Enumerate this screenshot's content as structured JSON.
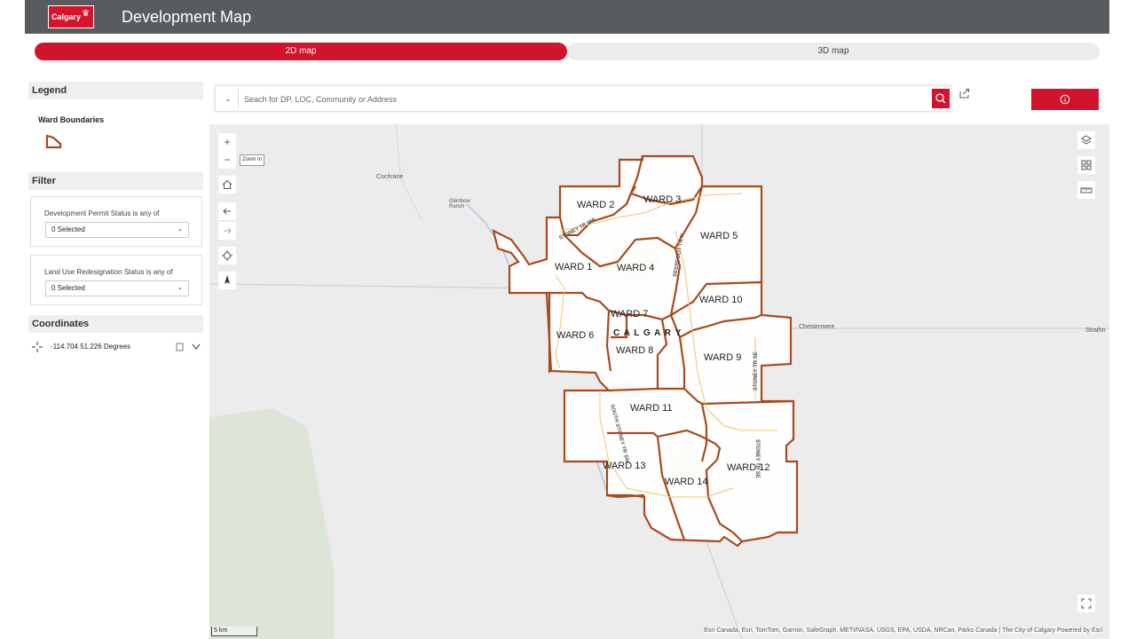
{
  "header": {
    "logo_text": "Calgary",
    "title": "Development Map"
  },
  "tabs": [
    {
      "label": "2D map",
      "active": true
    },
    {
      "label": "3D map",
      "active": false
    }
  ],
  "legend": {
    "heading": "Legend",
    "item_label": "Ward Boundaries",
    "swatch_color": "#a84a1e"
  },
  "filter": {
    "heading": "Filter",
    "development_permit": {
      "label": "Development Permit Status is any of",
      "value": "0 Selected"
    },
    "land_use": {
      "label": "Land Use Redesignation Status is any of",
      "value": "0 Selected"
    }
  },
  "coordinates": {
    "heading": "Coordinates",
    "value": "-114.704 51.226 Degrees"
  },
  "search": {
    "placeholder": "Seach for DP, LOC, Community or Address"
  },
  "map": {
    "tooltip": "Zoom In",
    "city_label": "C A L G A R Y",
    "scale_label": "5 km",
    "attribution": "Esri Canada, Esri, TomTom, Garmin, SafeGraph, METI/NASA, USGS, EPA, USDA, NRCan, Parks Canada | The City of Calgary     Powered by Esri",
    "places": {
      "cochrane": "Cochrane",
      "glenbow": "Glenbow Ranch",
      "chestermere": "Chestermere",
      "strathmore": "Strathn"
    },
    "roads": {
      "stoney_nw": "STONEY TR NW",
      "deerfoot": "DEERFOOT TR N",
      "stoney_se1": "STONEY TR SE",
      "stoney_se2": "STONEY TR SE",
      "stoney_sw": "SOUTH STONEY TR SW"
    },
    "wards": [
      "WARD 1",
      "WARD 2",
      "WARD 3",
      "WARD 4",
      "WARD 5",
      "WARD 6",
      "WARD 7",
      "WARD 8",
      "WARD 9",
      "WARD 10",
      "WARD 11",
      "WARD 12",
      "WARD 13",
      "WARD 14"
    ],
    "colors": {
      "accent": "#d0142c",
      "ward_line": "#a84a1e",
      "basemap": "#ececec",
      "park": "#c8dfb0",
      "water": "#a9c8e8"
    }
  }
}
